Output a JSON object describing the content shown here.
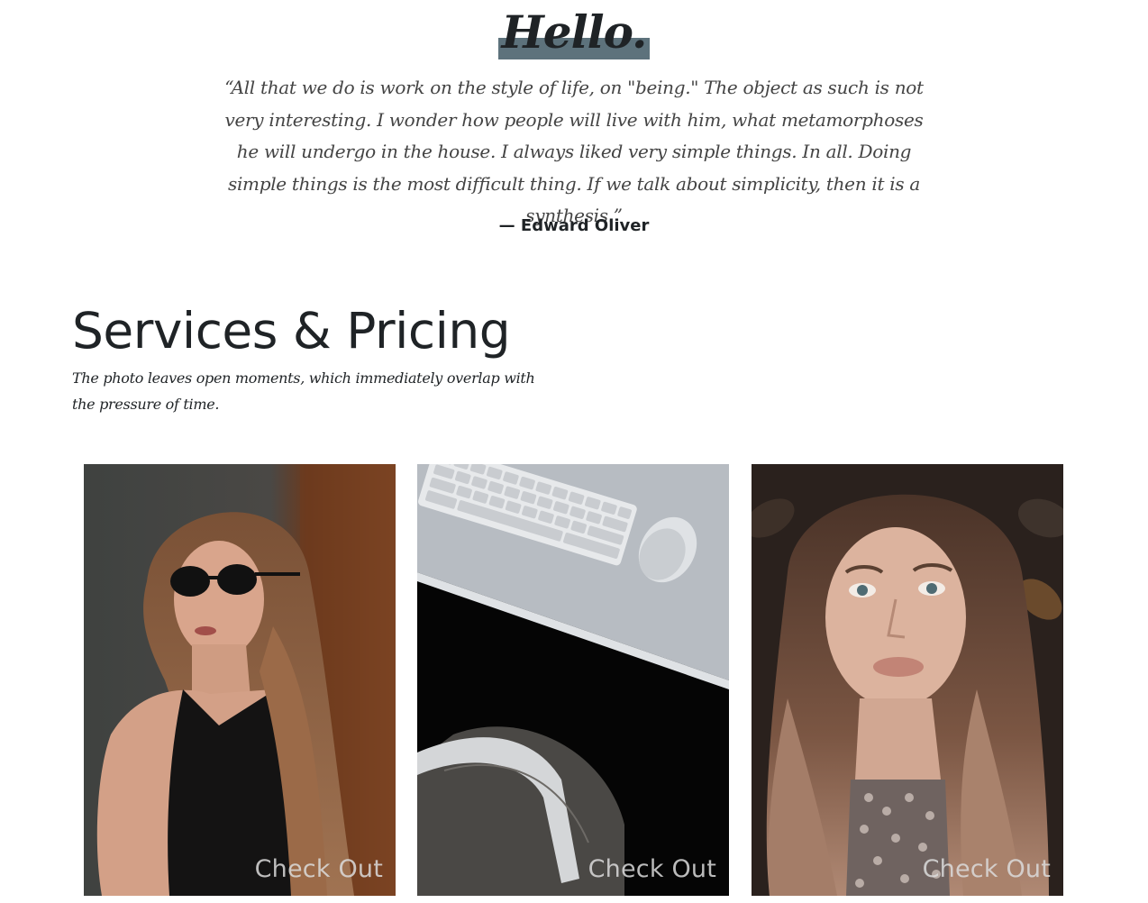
{
  "hero": {
    "title": "Hello.",
    "quote": "“All that we do is work on the style of life, on \"being.\" The object as such is not very interesting. I wonder how people will live with him, what metamorphoses he will undergo in the house. I always liked very simple things. In all. Doing simple things is the most difficult thing. If we talk about simplicity, then it is a synthesis.”",
    "author": "— Edward Oliver"
  },
  "services": {
    "title": "Services & Pricing",
    "subtitle": "The photo leaves open moments, which immediately overlap with the pressure of time."
  },
  "cards": [
    {
      "label": "Check Out",
      "image": "woman-sunglasses-photo"
    },
    {
      "label": "Check Out",
      "image": "desk-keyboard-mouse-photo"
    },
    {
      "label": "Check Out",
      "image": "woman-portrait-photo"
    }
  ],
  "colors": {
    "highlight": "#5d727c",
    "text": "#1f2326"
  }
}
